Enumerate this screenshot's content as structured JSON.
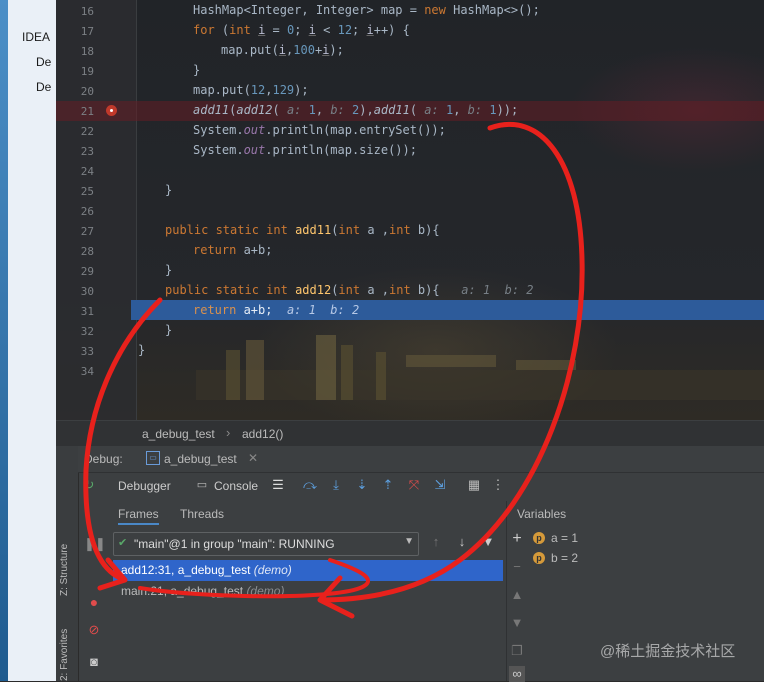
{
  "left_strip": {
    "items": [
      "IDEA",
      "De",
      "De"
    ]
  },
  "editor": {
    "lines": [
      {
        "n": "16",
        "code": "HashMap<Integer, Integer> map = new HashMap<>();"
      },
      {
        "n": "17",
        "code": "for (int i = 0; i < 12; i++) {"
      },
      {
        "n": "18",
        "code": "map.put(i,100+i);"
      },
      {
        "n": "19",
        "code": "}"
      },
      {
        "n": "20",
        "code": "map.put(12,129);"
      },
      {
        "n": "21",
        "code": "add11(add12( a: 1, b: 2),add11( a: 1, b: 1));"
      },
      {
        "n": "22",
        "code": "System.out.println(map.entrySet());"
      },
      {
        "n": "23",
        "code": "System.out.println(map.size());"
      },
      {
        "n": "24",
        "code": ""
      },
      {
        "n": "25",
        "code": "}"
      },
      {
        "n": "26",
        "code": ""
      },
      {
        "n": "27",
        "code": "public static int add11(int a ,int b){"
      },
      {
        "n": "28",
        "code": "return a+b;"
      },
      {
        "n": "29",
        "code": "}"
      },
      {
        "n": "30",
        "code": "public static int add12(int a ,int b){   a: 1  b: 2"
      },
      {
        "n": "31",
        "code": "return a+b;  a: 1  b: 2"
      },
      {
        "n": "32",
        "code": "}"
      },
      {
        "n": "33",
        "code": "}"
      },
      {
        "n": "34",
        "code": ""
      }
    ]
  },
  "breadcrumb": {
    "class_name": "a_debug_test",
    "method": "add12()"
  },
  "debug": {
    "title": "Debug:",
    "session_tab": "a_debug_test",
    "tabs": {
      "debugger": "Debugger",
      "console": "Console"
    },
    "subtabs": {
      "frames": "Frames",
      "threads": "Threads"
    },
    "thread": "\"main\"@1 in group \"main\": RUNNING",
    "frames": [
      {
        "loc": "add12:31, a_debug_test",
        "pkg": "(demo)",
        "selected": true
      },
      {
        "loc": "main:21, a_debug_test",
        "pkg": "(demo)",
        "selected": false
      }
    ],
    "variables_label": "Variables",
    "variables": [
      {
        "badge": "p",
        "text": "a = 1"
      },
      {
        "badge": "p",
        "text": "b = 2"
      }
    ],
    "side_labels": {
      "structure": "Z: Structure",
      "favorites": "2: Favorites"
    }
  },
  "watermark": "@稀土掘金技术社区",
  "colors": {
    "keyword": "#cc7832",
    "number": "#6897bb",
    "selection": "#2f65ca",
    "annotation": "#e8211c"
  }
}
